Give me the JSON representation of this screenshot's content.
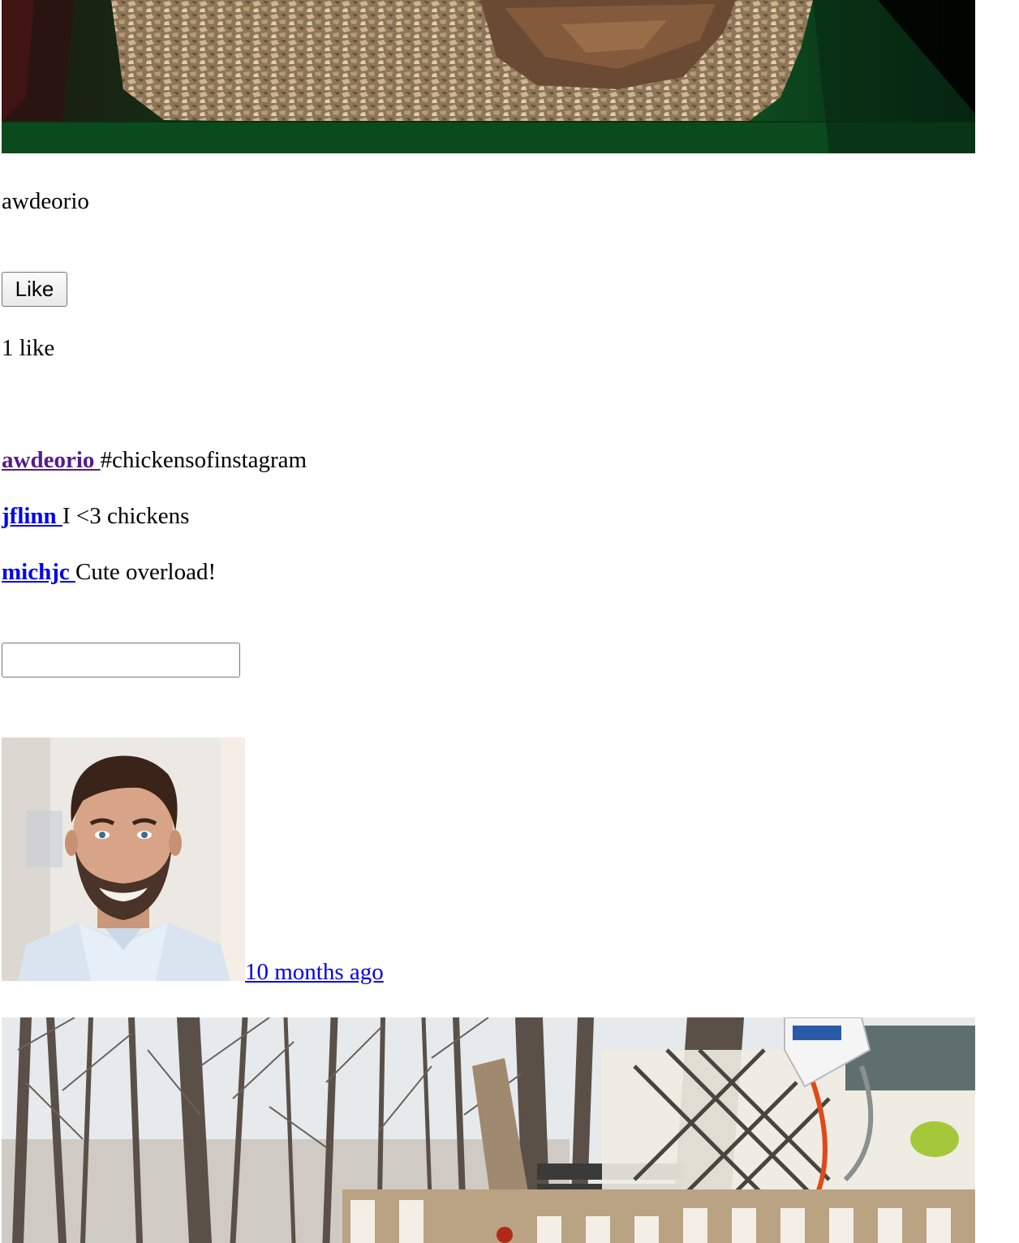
{
  "post1": {
    "image_description_icon": "chicken-nest-photo",
    "owner": "awdeorio",
    "like_button_label": "Like",
    "likes_text": "1 like",
    "comments": [
      {
        "owner": "awdeorio ",
        "text": " #chickensofinstagram",
        "link_color": "#551a8b"
      },
      {
        "owner": "jflinn ",
        "text": " I <3 chickens",
        "link_color": "#0000ee"
      },
      {
        "owner": "michjc ",
        "text": " Cute overload!",
        "link_color": "#0000ee"
      }
    ],
    "comment_input_value": ""
  },
  "post2": {
    "avatar_icon": "user-avatar-photo",
    "timestamp": "10 months ago",
    "image_icon": "chicken-coop-trees-photo"
  },
  "colors": {
    "link": "#0000ee",
    "visited_link": "#551a8b"
  }
}
